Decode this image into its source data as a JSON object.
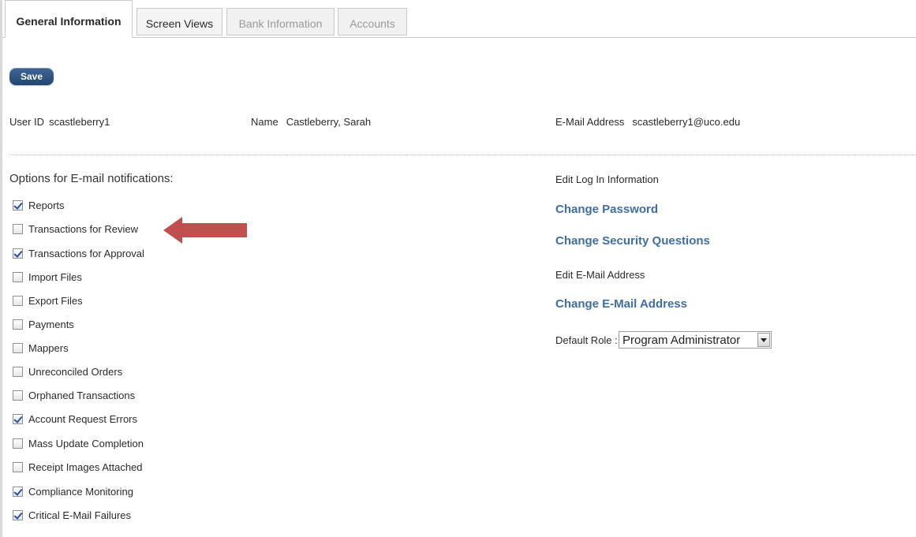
{
  "tabs": [
    {
      "label": "General Information",
      "state": "active"
    },
    {
      "label": "Screen Views",
      "state": "normal"
    },
    {
      "label": "Bank Information",
      "state": "disabled"
    },
    {
      "label": "Accounts",
      "state": "disabled"
    }
  ],
  "toolbar": {
    "save_label": "Save"
  },
  "user": {
    "id_label": "User ID",
    "id_value": "scastleberry1",
    "name_label": "Name",
    "name_value": "Castleberry, Sarah",
    "email_label": "E-Mail Address",
    "email_value": "scastleberry1@uco.edu"
  },
  "notifications": {
    "title": "Options for E-mail notifications:",
    "options": [
      {
        "label": "Reports",
        "checked": true
      },
      {
        "label": "Transactions for Review",
        "checked": false
      },
      {
        "label": "Transactions for Approval",
        "checked": true
      },
      {
        "label": "Import Files",
        "checked": false
      },
      {
        "label": "Export Files",
        "checked": false
      },
      {
        "label": "Payments",
        "checked": false
      },
      {
        "label": "Mappers",
        "checked": false
      },
      {
        "label": "Unreconciled Orders",
        "checked": false
      },
      {
        "label": "Orphaned Transactions",
        "checked": false
      },
      {
        "label": "Account Request Errors",
        "checked": true
      },
      {
        "label": "Mass Update Completion",
        "checked": false
      },
      {
        "label": "Receipt Images Attached",
        "checked": false
      },
      {
        "label": "Compliance Monitoring",
        "checked": true
      },
      {
        "label": "Critical E-Mail Failures",
        "checked": true
      }
    ]
  },
  "login": {
    "edit_login_label": "Edit Log In Information",
    "change_password": "Change Password",
    "change_security_questions": "Change Security Questions",
    "edit_email_label": "Edit E-Mail Address",
    "change_email": "Change E-Mail Address"
  },
  "role": {
    "label": "Default Role :",
    "selected": "Program Administrator"
  },
  "colors": {
    "accent_link": "#3f6ea5",
    "save_button": "#2a5080",
    "annotation_arrow": "#c0504d"
  },
  "annotation": {
    "icon": "red-arrow-left",
    "target": "Transactions for Review"
  }
}
